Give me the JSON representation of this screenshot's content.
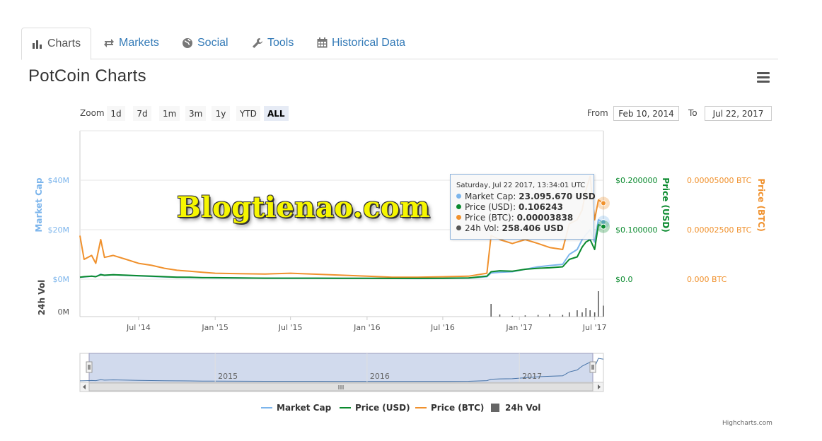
{
  "tabs": [
    {
      "label": "Charts",
      "icon": "bar-chart-icon"
    },
    {
      "label": "Markets",
      "icon": "exchange-icon"
    },
    {
      "label": "Social",
      "icon": "globe-icon"
    },
    {
      "label": "Tools",
      "icon": "wrench-icon"
    },
    {
      "label": "Historical Data",
      "icon": "calendar-icon"
    }
  ],
  "page_title": "PotCoin Charts",
  "zoom": {
    "label": "Zoom",
    "buttons": [
      "1d",
      "7d",
      "1m",
      "3m",
      "1y",
      "YTD",
      "ALL"
    ],
    "selected": "ALL"
  },
  "range": {
    "from_label": "From",
    "from": "Feb 10, 2014",
    "to_label": "To",
    "to": "Jul 22, 2017"
  },
  "watermark": "Blogtienao.com",
  "tooltip": {
    "title": "Saturday, Jul 22 2017, 13:34:01 UTC",
    "rows": [
      {
        "label": "Market Cap:",
        "value": "23.095.670 USD",
        "color": "#7cb5ec"
      },
      {
        "label": "Price (USD):",
        "value": "0.106243",
        "color": "#0a8a2e"
      },
      {
        "label": "Price (BTC):",
        "value": "0.00003838",
        "color": "#f0912d"
      },
      {
        "label": "24h Vol:",
        "value": "258.406 USD",
        "color": "#555555"
      }
    ]
  },
  "legend": [
    {
      "label": "Market Cap",
      "color": "#7cb5ec",
      "kind": "line"
    },
    {
      "label": "Price (USD)",
      "color": "#0a8a2e",
      "kind": "line"
    },
    {
      "label": "Price (BTC)",
      "color": "#f0912d",
      "kind": "line"
    },
    {
      "label": "24h Vol",
      "color": "#666666",
      "kind": "square"
    }
  ],
  "credits": "Highcharts.com",
  "chart_data": {
    "type": "line",
    "title": "PotCoin Charts",
    "x_ticks": [
      "Jul '14",
      "Jan '15",
      "Jul '15",
      "Jan '16",
      "Jul '16",
      "Jan '17",
      "Jul '17"
    ],
    "x_tick_dates": [
      "2014-07-01",
      "2015-01-01",
      "2015-07-01",
      "2016-01-01",
      "2016-07-01",
      "2017-01-01",
      "2017-07-01"
    ],
    "x_range": [
      "2014-02-10",
      "2017-07-22"
    ],
    "navigator_labels": [
      "2015",
      "2016",
      "2017"
    ],
    "axes": {
      "market_cap": {
        "label": "Market Cap",
        "ticks": [
          "$0M",
          "$20M",
          "$40M"
        ],
        "tick_values": [
          0,
          20000000,
          40000000
        ],
        "range": [
          0,
          60000000
        ],
        "color": "#7cb5ec"
      },
      "price_usd": {
        "label": "Price (USD)",
        "ticks": [
          "$0.0",
          "$0.100000",
          "$0.200000"
        ],
        "tick_values": [
          0,
          0.1,
          0.2
        ],
        "range": [
          0,
          0.3
        ],
        "color": "#0a8a2e"
      },
      "price_btc": {
        "label": "Price (BTC)",
        "ticks": [
          "0.000 BTC",
          "0.00002500 BTC",
          "0.00005000 BTC"
        ],
        "tick_values": [
          0,
          2.5e-05,
          5e-05
        ],
        "range": [
          0,
          7.5e-05
        ],
        "color": "#f0912d"
      },
      "volume": {
        "label": "24h Vol",
        "ticks": [
          "0M"
        ],
        "tick_values": [
          0
        ]
      }
    },
    "x": [
      "2014-02-10",
      "2014-02-20",
      "2014-03-10",
      "2014-03-20",
      "2014-04-01",
      "2014-04-10",
      "2014-05-01",
      "2014-06-01",
      "2014-07-01",
      "2014-08-01",
      "2014-09-01",
      "2014-10-01",
      "2014-11-01",
      "2014-12-01",
      "2015-01-01",
      "2015-03-01",
      "2015-05-01",
      "2015-07-01",
      "2015-09-01",
      "2015-11-01",
      "2016-01-01",
      "2016-03-01",
      "2016-05-01",
      "2016-07-01",
      "2016-09-01",
      "2016-10-15",
      "2016-10-25",
      "2016-11-15",
      "2016-12-15",
      "2017-01-15",
      "2017-02-15",
      "2017-03-15",
      "2017-04-15",
      "2017-05-01",
      "2017-05-20",
      "2017-06-01",
      "2017-06-10",
      "2017-06-20",
      "2017-07-01",
      "2017-07-10",
      "2017-07-22"
    ],
    "series": [
      {
        "name": "Market Cap",
        "axis": "market_cap",
        "color": "#7cb5ec",
        "values": [
          800000,
          900000,
          1200000,
          1000000,
          2000000,
          1500000,
          1800000,
          1500000,
          1300000,
          1100000,
          900000,
          800000,
          700000,
          600000,
          500000,
          450000,
          400000,
          380000,
          350000,
          320000,
          300000,
          280000,
          260000,
          280000,
          400000,
          1000000,
          2500000,
          2800000,
          3000000,
          4000000,
          5000000,
          5500000,
          6000000,
          10000000,
          12000000,
          16000000,
          18000000,
          20000000,
          15000000,
          24000000,
          23095670
        ]
      },
      {
        "name": "Price (USD)",
        "axis": "price_usd",
        "color": "#0a8a2e",
        "values": [
          0.004,
          0.005,
          0.006,
          0.005,
          0.009,
          0.008,
          0.009,
          0.008,
          0.007,
          0.006,
          0.005,
          0.004,
          0.004,
          0.003,
          0.003,
          0.0025,
          0.002,
          0.002,
          0.002,
          0.0018,
          0.0017,
          0.0016,
          0.0016,
          0.0018,
          0.0025,
          0.006,
          0.015,
          0.017,
          0.016,
          0.02,
          0.022,
          0.023,
          0.025,
          0.04,
          0.045,
          0.065,
          0.075,
          0.08,
          0.06,
          0.11,
          0.106243
        ]
      },
      {
        "name": "Price (BTC)",
        "axis": "price_btc",
        "color": "#f0912d",
        "values": [
          2.2e-05,
          1e-05,
          1.2e-05,
          8e-06,
          2e-05,
          1.1e-05,
          1.2e-05,
          1e-05,
          8e-06,
          7e-06,
          5.5e-06,
          4.5e-06,
          4e-06,
          3.5e-06,
          3e-06,
          2.8e-06,
          2.6e-06,
          3e-06,
          2.5e-06,
          2e-06,
          1.5e-06,
          1e-06,
          1e-06,
          1.2e-06,
          1.5e-06,
          3e-06,
          2.2e-05,
          2e-05,
          1.8e-05,
          2e-05,
          1.8e-05,
          1.6e-05,
          1.5e-05,
          2.8e-05,
          3e-05,
          3.5e-05,
          4.5e-05,
          5.2e-05,
          3e-05,
          4e-05,
          3.838e-05
        ]
      },
      {
        "name": "24h Vol",
        "axis": "volume",
        "color": "#555555",
        "values": [
          0,
          0,
          0,
          0,
          0,
          0,
          0,
          0,
          0,
          0,
          0,
          0,
          0,
          0,
          0,
          0,
          0,
          0,
          0,
          0,
          0,
          0,
          0,
          0,
          0,
          0,
          300000,
          50000,
          20000,
          30000,
          40000,
          60000,
          40000,
          100000,
          150000,
          100000,
          200000,
          150000,
          100000,
          600000,
          258406
        ]
      }
    ],
    "grid": true,
    "legend_position": "bottom-center"
  }
}
